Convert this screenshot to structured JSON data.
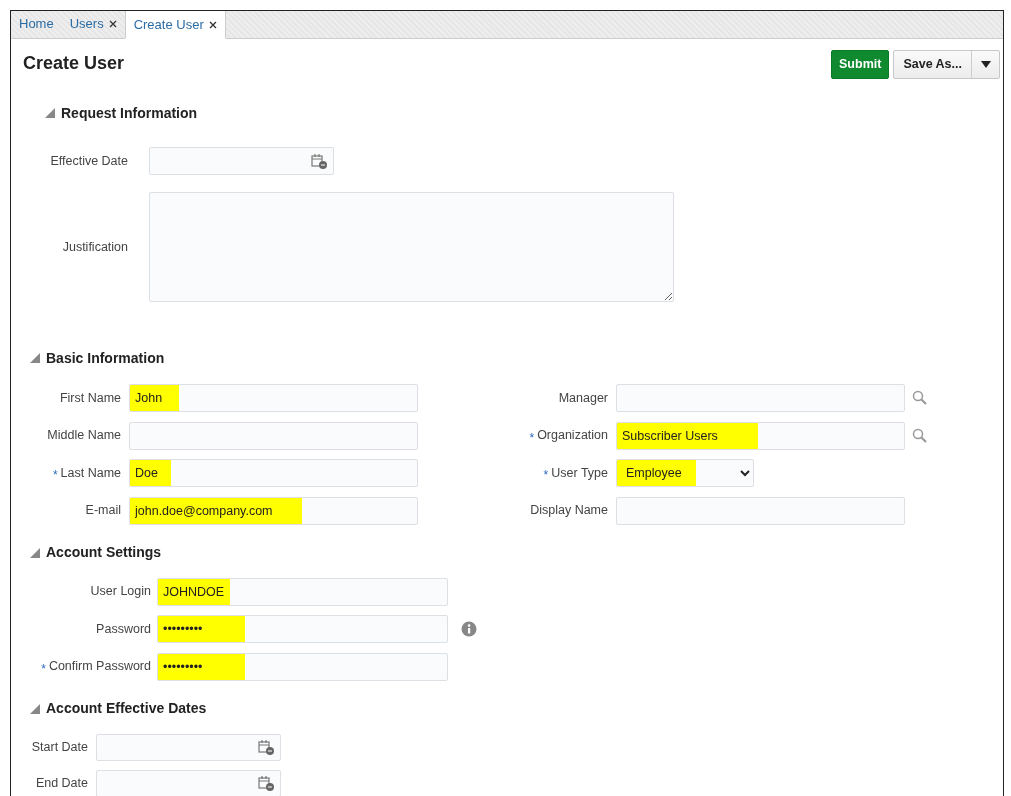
{
  "tabs": [
    {
      "label": "Home",
      "closable": false,
      "selected": false
    },
    {
      "label": "Users",
      "closable": true,
      "selected": false
    },
    {
      "label": "Create User",
      "closable": true,
      "selected": true
    }
  ],
  "title": "Create User",
  "buttons": {
    "submit": "Submit",
    "save_as": "Save As..."
  },
  "sections": [
    {
      "title": "Request Information",
      "expanded": true,
      "columns": [
        [
          {
            "label": "Effective Date",
            "kind": "date",
            "highlighted": false
          },
          {
            "label": "Justification",
            "kind": "textarea",
            "highlighted": false
          }
        ]
      ]
    },
    {
      "title": "Basic Information",
      "expanded": true,
      "columns": [
        [
          {
            "label": "First Name",
            "kind": "text",
            "value": "John",
            "highlighted": true
          },
          {
            "label": "Middle Name",
            "kind": "text",
            "highlighted": false
          },
          {
            "label": "Last Name",
            "marker": "*",
            "kind": "text",
            "value": "Doe",
            "highlighted": true
          },
          {
            "label": "E-mail",
            "kind": "text",
            "value": "john.doe@company.com",
            "highlighted": true
          }
        ],
        [
          {
            "label": "Manager",
            "kind": "lookup",
            "highlighted": false
          },
          {
            "label": "Organization",
            "marker": "*",
            "kind": "lookup",
            "value": "Subscriber Users",
            "highlighted": true
          },
          {
            "label": "User Type",
            "marker": "*",
            "kind": "select",
            "value": "Employee",
            "highlighted": true
          },
          {
            "label": "Display Name",
            "kind": "text",
            "highlighted": false
          }
        ]
      ]
    },
    {
      "title": "Account Settings",
      "expanded": true,
      "columns": [
        [
          {
            "label": "User Login",
            "kind": "text",
            "value": "JOHNDOE",
            "highlighted": true
          },
          {
            "label": "Password",
            "kind": "text",
            "value": "•••••••••",
            "highlighted": true,
            "has_info": true
          },
          {
            "label": "Confirm Password",
            "marker": "*",
            "kind": "text",
            "value": "•••••••••",
            "highlighted": true
          }
        ]
      ]
    },
    {
      "title": "Account Effective Dates",
      "expanded": true,
      "columns": [
        [
          {
            "label": "Start Date",
            "kind": "date",
            "highlighted": false
          },
          {
            "label": "End Date",
            "kind": "date",
            "highlighted": false
          }
        ]
      ]
    }
  ]
}
